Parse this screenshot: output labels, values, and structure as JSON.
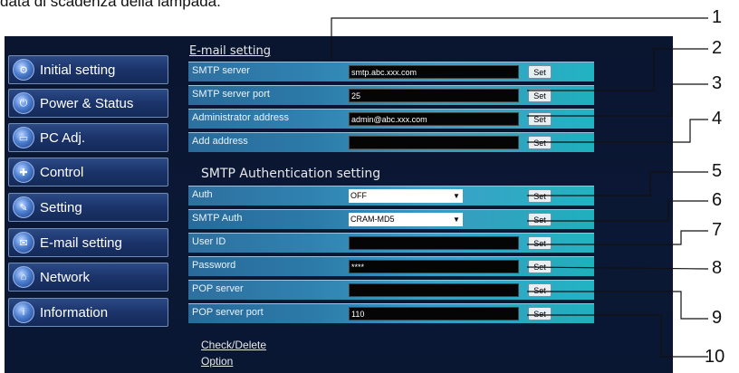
{
  "caption": "data di scadenza della lampada.",
  "sidebar": {
    "items": [
      {
        "label": "Initial setting",
        "icon": "gear-icon"
      },
      {
        "label": "Power & Status",
        "icon": "power-icon"
      },
      {
        "label": "PC Adj.",
        "icon": "monitor-icon"
      },
      {
        "label": "Control",
        "icon": "control-icon"
      },
      {
        "label": "Setting",
        "icon": "wrench-icon"
      },
      {
        "label": "E-mail setting",
        "icon": "envelope-icon"
      },
      {
        "label": "Network",
        "icon": "network-icon"
      },
      {
        "label": "Information",
        "icon": "info-icon"
      }
    ]
  },
  "email_section": {
    "title": "E-mail setting",
    "rows": [
      {
        "label": "SMTP server",
        "value": "smtp.abc.xxx.com",
        "button": "Set"
      },
      {
        "label": "SMTP server port",
        "value": "25",
        "button": "Set"
      },
      {
        "label": "Administrator address",
        "value": "admin@abc.xxx.com",
        "button": "Set"
      },
      {
        "label": "Add address",
        "value": "",
        "button": "Set"
      }
    ]
  },
  "auth_section": {
    "title": "SMTP Authentication setting",
    "rows": [
      {
        "label": "Auth",
        "value": "OFF",
        "button": "Set"
      },
      {
        "label": "SMTP Auth",
        "value": "CRAM-MD5",
        "button": "Set"
      },
      {
        "label": "User ID",
        "value": "",
        "button": "Set"
      },
      {
        "label": "Password",
        "value": "****",
        "button": "Set"
      },
      {
        "label": "POP server",
        "value": "",
        "button": "Set"
      },
      {
        "label": "POP server port",
        "value": "110",
        "button": "Set"
      }
    ]
  },
  "links": {
    "check_delete": "Check/Delete",
    "option": "Option"
  },
  "callouts": [
    "1",
    "2",
    "3",
    "4",
    "5",
    "6",
    "7",
    "8",
    "9",
    "10"
  ]
}
